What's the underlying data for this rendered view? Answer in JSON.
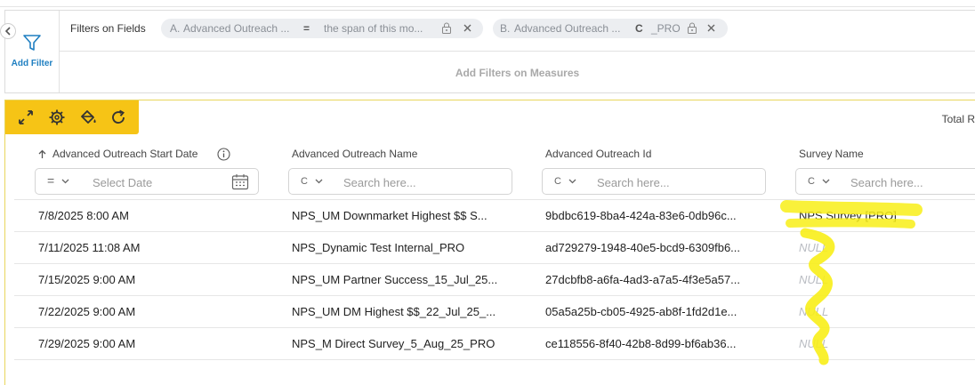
{
  "filters": {
    "add_filter_label": "Add Filter",
    "fields_label": "Filters on Fields",
    "chips": [
      {
        "letter": "A.",
        "field": "Advanced Outreach ...",
        "operator": "=",
        "value": "the span of this mo..."
      },
      {
        "letter": "B.",
        "field": "Advanced Outreach ...",
        "operator": "C",
        "value": "_PRO"
      }
    ],
    "measures_label": "Add Filters on Measures"
  },
  "grid": {
    "total_label": "Total R",
    "columns": [
      {
        "label": "Advanced Outreach Start Date",
        "sort": "ascending",
        "filter_operator": "=",
        "placeholder": "Select Date"
      },
      {
        "label": "Advanced Outreach Name",
        "filter_operator": "C",
        "placeholder": "Search here..."
      },
      {
        "label": "Advanced Outreach Id",
        "filter_operator": "C",
        "placeholder": "Search here..."
      },
      {
        "label": "Survey Name",
        "filter_operator": "C",
        "placeholder": "Search here..."
      }
    ],
    "rows": [
      {
        "start": "7/8/2025 8:00 AM",
        "name": "NPS_UM Downmarket Highest $$ S...",
        "id": "9bdbc619-8ba4-424a-83e6-0db96c...",
        "survey": "NPS Survey [PRO]"
      },
      {
        "start": "7/11/2025 11:08 AM",
        "name": "NPS_Dynamic Test Internal_PRO",
        "id": "ad729279-1948-40e5-bcd9-6309fb6...",
        "survey": "NULL"
      },
      {
        "start": "7/15/2025 9:00 AM",
        "name": "NPS_UM Partner Success_15_Jul_25...",
        "id": "27dcbfb8-a6fa-4ad3-a7a5-4f3e5a57...",
        "survey": "NULL"
      },
      {
        "start": "7/22/2025 9:00 AM",
        "name": "NPS_UM DM Highest $$_22_Jul_25_...",
        "id": "05a5a25b-cb05-4925-ab8f-1fd2d1e...",
        "survey": "NULL"
      },
      {
        "start": "7/29/2025 9:00 AM",
        "name": "NPS_M Direct Survey_5_Aug_25_PRO",
        "id": "ce118556-8f40-42b8-8d99-bf6ab36...",
        "survey": "NULL"
      }
    ]
  },
  "colors": {
    "toolbar": "#f6c416",
    "highlight": "#f8ee18",
    "link": "#1f7fc1",
    "chip_bg": "#eceef1"
  },
  "icons": [
    "chevron-left-icon",
    "filter-icon",
    "lock-icon",
    "close-icon",
    "expand-icon",
    "gear-icon",
    "paint-bucket-icon",
    "refresh-icon",
    "sort-up-icon",
    "info-icon",
    "calendar-icon",
    "chevron-down-icon"
  ]
}
